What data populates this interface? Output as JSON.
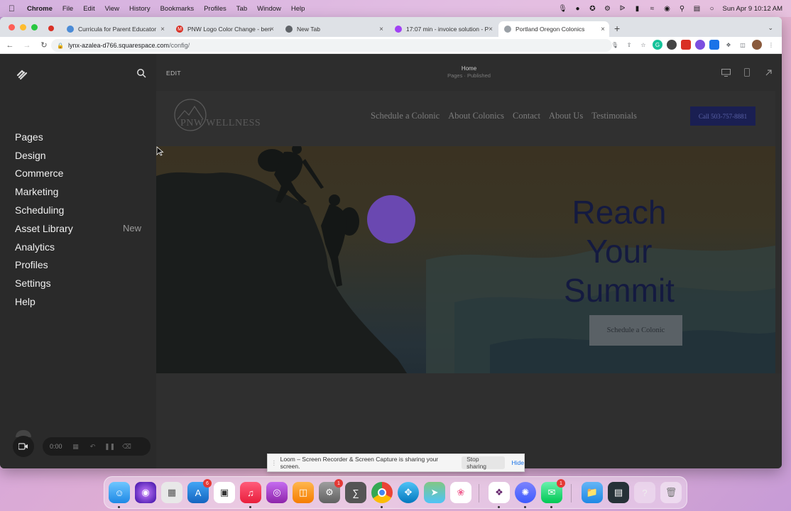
{
  "menubar": {
    "app_name": "Chrome",
    "menus": [
      "File",
      "Edit",
      "View",
      "History",
      "Bookmarks",
      "Profiles",
      "Tab",
      "Window",
      "Help"
    ],
    "clock": "Sun Apr 9  10:12 AM"
  },
  "browser": {
    "tabs": [
      {
        "title": "Curricula for Parent Educator",
        "color": "#4b8bd6"
      },
      {
        "title": "PNW Logo Color Change - ben",
        "color": "#d93025"
      },
      {
        "title": "New Tab",
        "color": "#5f6368"
      },
      {
        "title": "17:07 min - invoice solution - P",
        "color": "#a142f4"
      },
      {
        "title": "Portland Oregon Colonics",
        "color": "#9aa0a6"
      }
    ],
    "url_host": "lynx-azalea-d766.squarespace.com",
    "url_path": "/config/"
  },
  "sidebar": {
    "items": [
      {
        "label": "Pages"
      },
      {
        "label": "Design"
      },
      {
        "label": "Commerce"
      },
      {
        "label": "Marketing"
      },
      {
        "label": "Scheduling"
      },
      {
        "label": "Asset Library",
        "badge": "New"
      },
      {
        "label": "Analytics"
      },
      {
        "label": "Profiles"
      },
      {
        "label": "Settings"
      },
      {
        "label": "Help"
      }
    ],
    "recorder_time": "0:00"
  },
  "editor": {
    "edit_label": "EDIT",
    "page_title": "Home",
    "page_status": "Pages · Published"
  },
  "site": {
    "logo_text": "PNW WELLNESS",
    "nav": [
      "Schedule a Colonic",
      "About Colonics",
      "Contact",
      "About Us",
      "Testimonials"
    ],
    "call_button": "Call 503-757-8881",
    "hero_title_lines": [
      "Reach",
      "Your",
      "Summit"
    ],
    "hero_cta": "Schedule a Colonic"
  },
  "share_notice": {
    "message": "Loom – Screen Recorder & Screen Capture is sharing your screen.",
    "stop_label": "Stop sharing",
    "hide_label": "Hide"
  },
  "dock": {
    "badges": {
      "appstore": "6",
      "settings": "1",
      "messages": "1"
    }
  },
  "colors": {
    "brand_navy": "#1a1f52",
    "sidebar_bg": "#2a2a2a",
    "loom_purple": "#7b4fe0"
  }
}
